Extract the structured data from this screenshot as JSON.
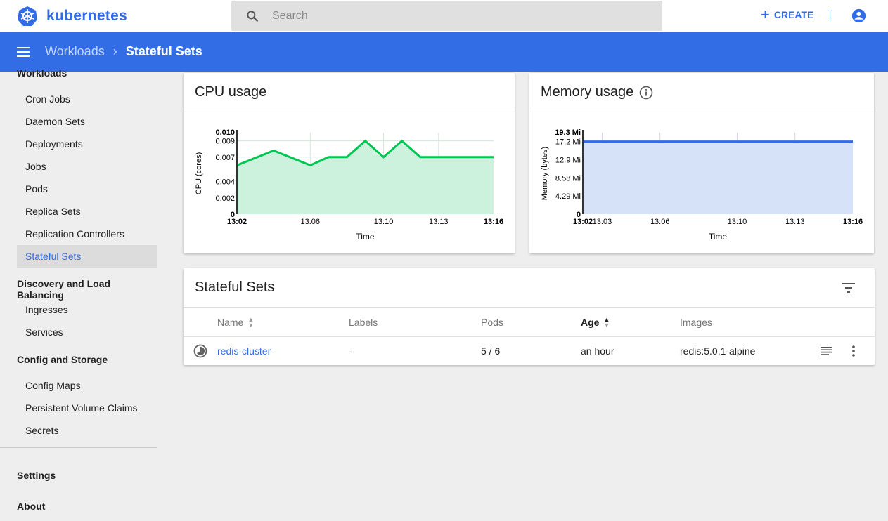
{
  "header": {
    "logo_text": "kubernetes",
    "search_placeholder": "Search",
    "create_label": "CREATE"
  },
  "breadcrumb": {
    "parent": "Workloads",
    "current": "Stateful Sets"
  },
  "sidebar": {
    "sections": [
      {
        "title": "Workloads",
        "items": [
          "Cron Jobs",
          "Daemon Sets",
          "Deployments",
          "Jobs",
          "Pods",
          "Replica Sets",
          "Replication Controllers",
          "Stateful Sets"
        ]
      },
      {
        "title": "Discovery and Load Balancing",
        "items": [
          "Ingresses",
          "Services"
        ]
      },
      {
        "title": "Config and Storage",
        "items": [
          "Config Maps",
          "Persistent Volume Claims",
          "Secrets"
        ]
      }
    ],
    "active": "Stateful Sets",
    "footer": [
      "Settings",
      "About"
    ]
  },
  "chart_data": [
    {
      "type": "area",
      "title": "CPU usage",
      "xlabel": "Time",
      "ylabel": "CPU (cores)",
      "x": [
        "13:02",
        "13:04",
        "13:06",
        "13:07",
        "13:08",
        "13:09",
        "13:10",
        "13:11",
        "13:12",
        "13:16"
      ],
      "values": [
        0.006,
        0.0078,
        0.006,
        0.007,
        0.007,
        0.009,
        0.007,
        0.009,
        0.007,
        0.007
      ],
      "ylim": [
        0,
        0.01
      ],
      "yticks": [
        "0",
        "0.002",
        "0.004",
        "0.007",
        "0.009",
        "0.010"
      ],
      "ytick_values": [
        0,
        0.002,
        0.004,
        0.007,
        0.009,
        0.01
      ],
      "xticks": [
        "13:02",
        "13:06",
        "13:10",
        "13:13",
        "13:16"
      ],
      "grid": true,
      "color": "#00c752",
      "fill": "#ccf2de"
    },
    {
      "type": "area",
      "title": "Memory usage",
      "xlabel": "Time",
      "ylabel": "Memory (bytes)",
      "x": [
        "13:02",
        "13:16"
      ],
      "values": [
        17.2,
        17.2
      ],
      "ylim": [
        0,
        19.3
      ],
      "yticks": [
        "0",
        "4.29 Mi",
        "8.58 Mi",
        "12.9 Mi",
        "17.2 Mi",
        "19.3 Mi"
      ],
      "ytick_values": [
        0,
        4.29,
        8.58,
        12.9,
        17.2,
        19.3
      ],
      "xticks": [
        "13:02",
        "13:03",
        "13:06",
        "13:10",
        "13:13",
        "13:16"
      ],
      "grid": true,
      "color": "#326de6",
      "fill": "#d6e2f8"
    }
  ],
  "table": {
    "title": "Stateful Sets",
    "columns": [
      "Name",
      "Labels",
      "Pods",
      "Age",
      "Images"
    ],
    "rows": [
      {
        "name": "redis-cluster",
        "labels": "-",
        "pods": "5 / 6",
        "age": "an hour",
        "images": "redis:5.0.1-alpine"
      }
    ]
  }
}
